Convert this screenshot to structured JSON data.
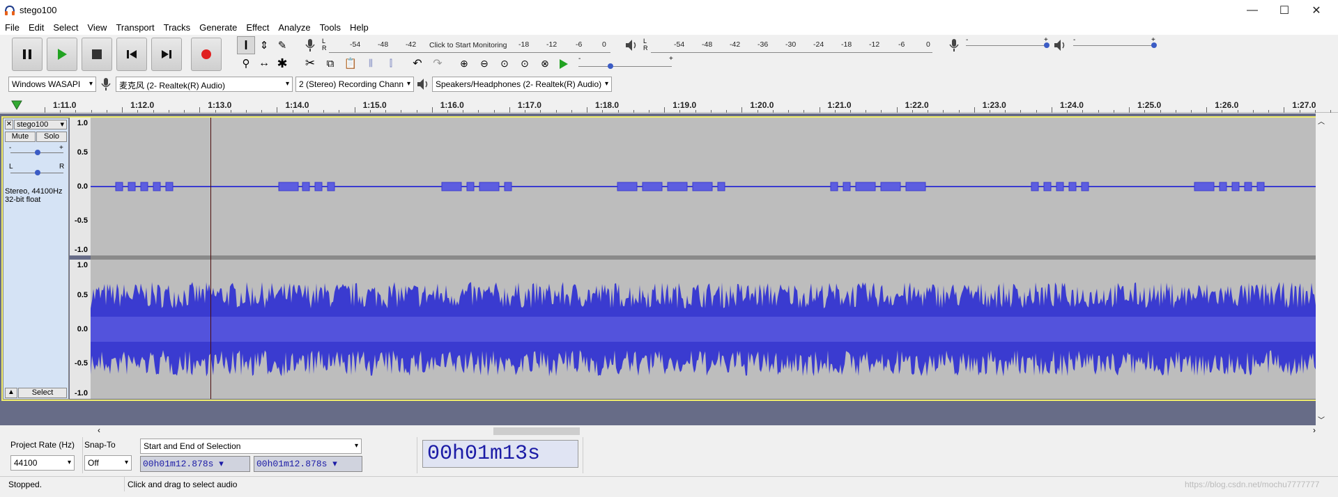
{
  "window": {
    "title": "stego100",
    "minimize": "—",
    "maximize": "☐",
    "close": "✕"
  },
  "menu": [
    "File",
    "Edit",
    "Select",
    "View",
    "Transport",
    "Tracks",
    "Generate",
    "Effect",
    "Analyze",
    "Tools",
    "Help"
  ],
  "transport": {
    "pause": "pause-icon",
    "play": "play-icon",
    "stop": "stop-icon",
    "skip_start": "skip-start-icon",
    "skip_end": "skip-end-icon",
    "record": "record-icon"
  },
  "record_meter": {
    "scale": [
      "-54",
      "-48",
      "-42",
      "Click to Start Monitoring",
      "-18",
      "-12",
      "-6",
      "0"
    ]
  },
  "play_meter": {
    "scale": [
      "-54",
      "-48",
      "-42",
      "-36",
      "-30",
      "-24",
      "-18",
      "-12",
      "-6",
      "0"
    ]
  },
  "slider_minus": "-",
  "slider_plus": "+",
  "device": {
    "host": "Windows WASAPI",
    "mic": "麦克风 (2- Realtek(R) Audio)",
    "channels": "2 (Stereo) Recording Chann",
    "speaker": "Speakers/Headphones (2- Realtek(R) Audio)"
  },
  "ruler": {
    "labels": [
      "1:11.0",
      "1:12.0",
      "1:13.0",
      "1:14.0",
      "1:15.0",
      "1:16.0",
      "1:17.0",
      "1:18.0",
      "1:19.0",
      "1:20.0",
      "1:21.0",
      "1:22.0",
      "1:23.0",
      "1:24.0",
      "1:25.0",
      "1:26.0",
      "1:27.0"
    ]
  },
  "track": {
    "name": "stego100",
    "mute": "Mute",
    "solo": "Solo",
    "gain_minus": "-",
    "gain_plus": "+",
    "pan_left": "L",
    "pan_right": "R",
    "info1": "Stereo, 44100Hz",
    "info2": "32-bit float",
    "select": "Select",
    "scale": [
      "1.0",
      "0.5",
      "0.0",
      "-0.5",
      "-1.0"
    ]
  },
  "bottom": {
    "project_rate_label": "Project Rate (Hz)",
    "project_rate": "44100",
    "snap_label": "Snap-To",
    "snap_value": "Off",
    "selection_mode": "Start and End of Selection",
    "sel_start": "00h01m12.878s",
    "sel_end": "00h01m12.878s",
    "position": "00h01m13s"
  },
  "status": {
    "state": "Stopped.",
    "hint": "Click and drag to select audio",
    "watermark": "https://blog.csdn.net/mochu7777777"
  },
  "colors": {
    "wave": "#3a3bd0",
    "track_bg": "#bdbdbd",
    "selection_border": "#f2ee6c",
    "record": "#e02020",
    "play": "#22a322"
  }
}
